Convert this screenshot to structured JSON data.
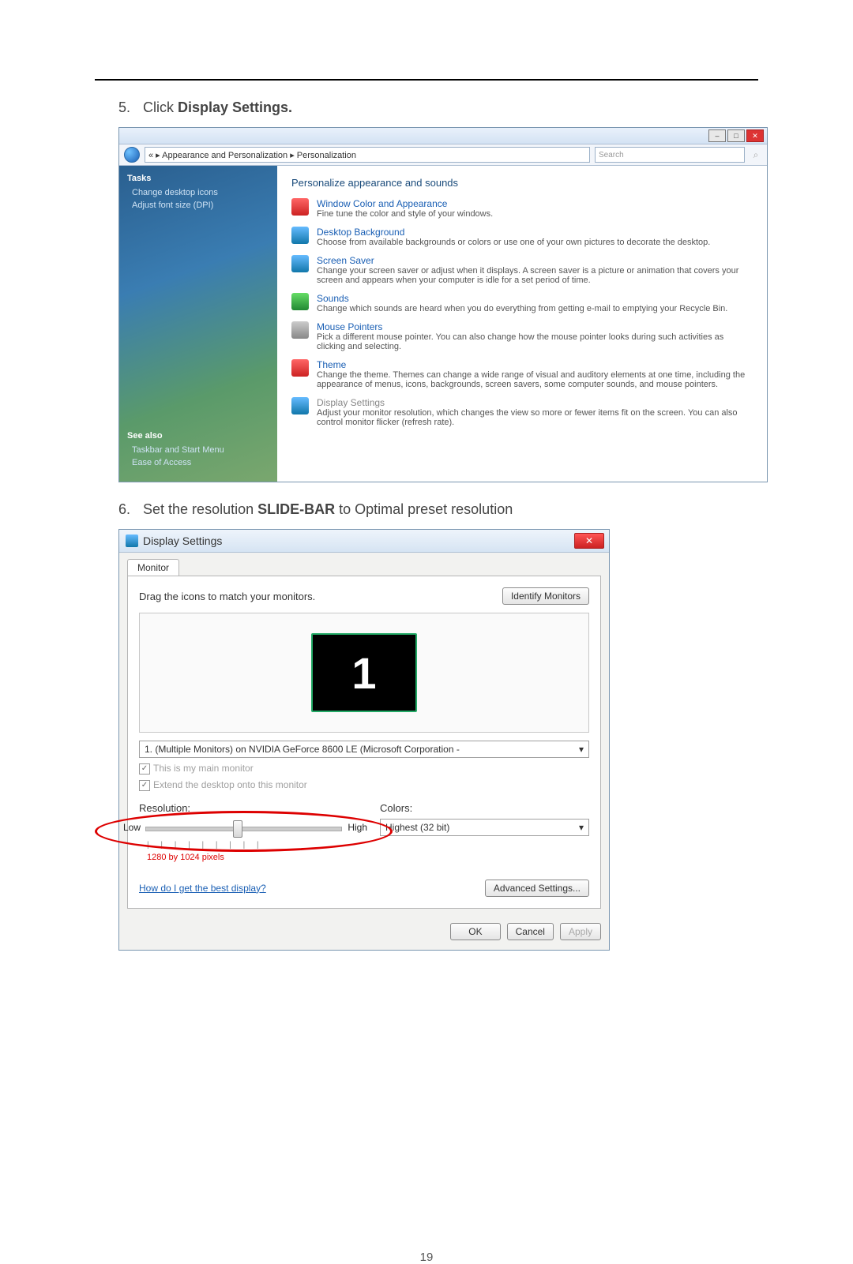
{
  "step5": {
    "num": "5.",
    "text_prefix": "Click ",
    "bold": "Display Settings."
  },
  "step6": {
    "num": "6.",
    "text_a": "Set the resolution ",
    "bold": "SLIDE-BAR",
    "text_b": " to Optimal preset resolution"
  },
  "vista": {
    "breadcrumb": "« ▸ Appearance and Personalization ▸ Personalization",
    "search_placeholder": "Search",
    "side": {
      "tasks": "Tasks",
      "link1": "Change desktop icons",
      "link2": "Adjust font size (DPI)",
      "seealso": "See also",
      "see1": "Taskbar and Start Menu",
      "see2": "Ease of Access"
    },
    "main_title": "Personalize appearance and sounds",
    "items": [
      {
        "title": "Window Color and Appearance",
        "desc": "Fine tune the color and style of your windows."
      },
      {
        "title": "Desktop Background",
        "desc": "Choose from available backgrounds or colors or use one of your own pictures to decorate the desktop."
      },
      {
        "title": "Screen Saver",
        "desc": "Change your screen saver or adjust when it displays. A screen saver is a picture or animation that covers your screen and appears when your computer is idle for a set period of time."
      },
      {
        "title": "Sounds",
        "desc": "Change which sounds are heard when you do everything from getting e-mail to emptying your Recycle Bin."
      },
      {
        "title": "Mouse Pointers",
        "desc": "Pick a different mouse pointer. You can also change how the mouse pointer looks during such activities as clicking and selecting."
      },
      {
        "title": "Theme",
        "desc": "Change the theme. Themes can change a wide range of visual and auditory elements at one time, including the appearance of menus, icons, backgrounds, screen savers, some computer sounds, and mouse pointers."
      },
      {
        "title": "Display Settings",
        "desc": "Adjust your monitor resolution, which changes the view so more or fewer items fit on the screen. You can also control monitor flicker (refresh rate)."
      }
    ]
  },
  "ds": {
    "title": "Display Settings",
    "close": "✕",
    "tab": "Monitor",
    "drag": "Drag the icons to match your monitors.",
    "identify": "Identify Monitors",
    "mon1": "1",
    "drop": "1. (Multiple Monitors) on NVIDIA GeForce 8600 LE (Microsoft Corporation -",
    "chk_main": "This is my main monitor",
    "chk_ext": "Extend the desktop onto this monitor",
    "res_label": "Resolution:",
    "low": "Low",
    "high": "High",
    "px": "1280 by 1024 pixels",
    "color_label": "Colors:",
    "color_val": "Highest (32 bit)",
    "help": "How do I get the best display?",
    "adv": "Advanced Settings...",
    "ok": "OK",
    "cancel": "Cancel",
    "apply": "Apply"
  },
  "pagenum": "19"
}
